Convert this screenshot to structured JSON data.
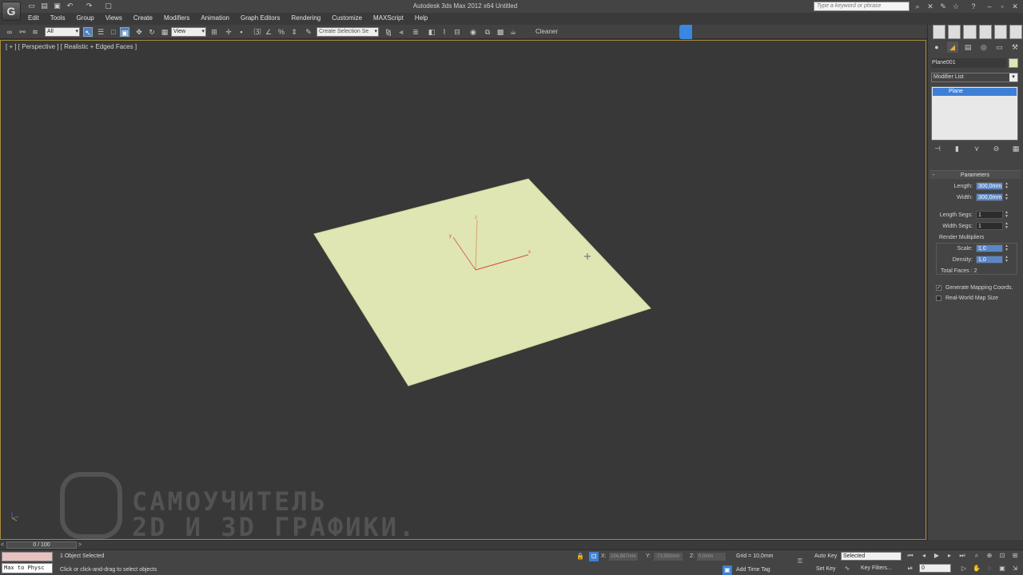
{
  "window": {
    "title": "Autodesk 3ds Max 2012 x64     Untitled",
    "search_placeholder": "Type a keyword or phrase"
  },
  "menu": [
    "Edit",
    "Tools",
    "Group",
    "Views",
    "Create",
    "Modifiers",
    "Animation",
    "Graph Editors",
    "Rendering",
    "Customize",
    "MAXScript",
    "Help"
  ],
  "toolbar": {
    "filter_value": "All",
    "refcoord_value": "View",
    "selection_set_placeholder": "Create Selection Se",
    "cleaner_label": "Cleaner"
  },
  "viewport": {
    "label": "[ + ] [ Perspective ] [ Realistic + Edged Faces ]",
    "plane_color": "#dfe6b3",
    "axis_labels": {
      "x": "x",
      "y": "y",
      "z": "z"
    }
  },
  "watermark": {
    "line1": "САМОУЧИТЕЛЬ",
    "line2": "2D И 3D ГРАФИКИ."
  },
  "command_panel": {
    "object_name": "Plane001",
    "object_color": "#dfe6b3",
    "modifier_list": "Modifier List",
    "stack_items": [
      "Plane"
    ],
    "rollout_title": "Parameters",
    "length_label": "Length:",
    "length_value": "300,0mm",
    "width_label": "Width:",
    "width_value": "300,0mm",
    "length_segs_label": "Length Segs:",
    "length_segs_value": "1",
    "width_segs_label": "Width Segs:",
    "width_segs_value": "1",
    "render_mult_title": "Render Multipliers",
    "scale_label": "Scale:",
    "scale_value": "1,0",
    "density_label": "Density:",
    "density_value": "1,0",
    "total_faces": "Total Faces : 2",
    "gen_mapping": "Generate Mapping Coords.",
    "gen_mapping_checked": true,
    "real_world": "Real-World Map Size",
    "real_world_checked": false
  },
  "time_slider": {
    "position": "0 / 100"
  },
  "status": {
    "maxscript_cmd": "Max to Physc",
    "selected": "1 Object Selected",
    "prompt": "Click or click-and-drag to select objects",
    "x_label": "X:",
    "x_value": "154,887mm",
    "y_label": "Y:",
    "y_value": "-73,593mm",
    "z_label": "Z:",
    "z_value": "0,0mm",
    "grid": "Grid = 10,0mm",
    "add_time_tag": "Add Time Tag",
    "auto_key": "Auto Key",
    "set_key": "Set Key",
    "auto_key_mode": "Selected",
    "key_filters": "Key Filters...",
    "frame": "0"
  }
}
